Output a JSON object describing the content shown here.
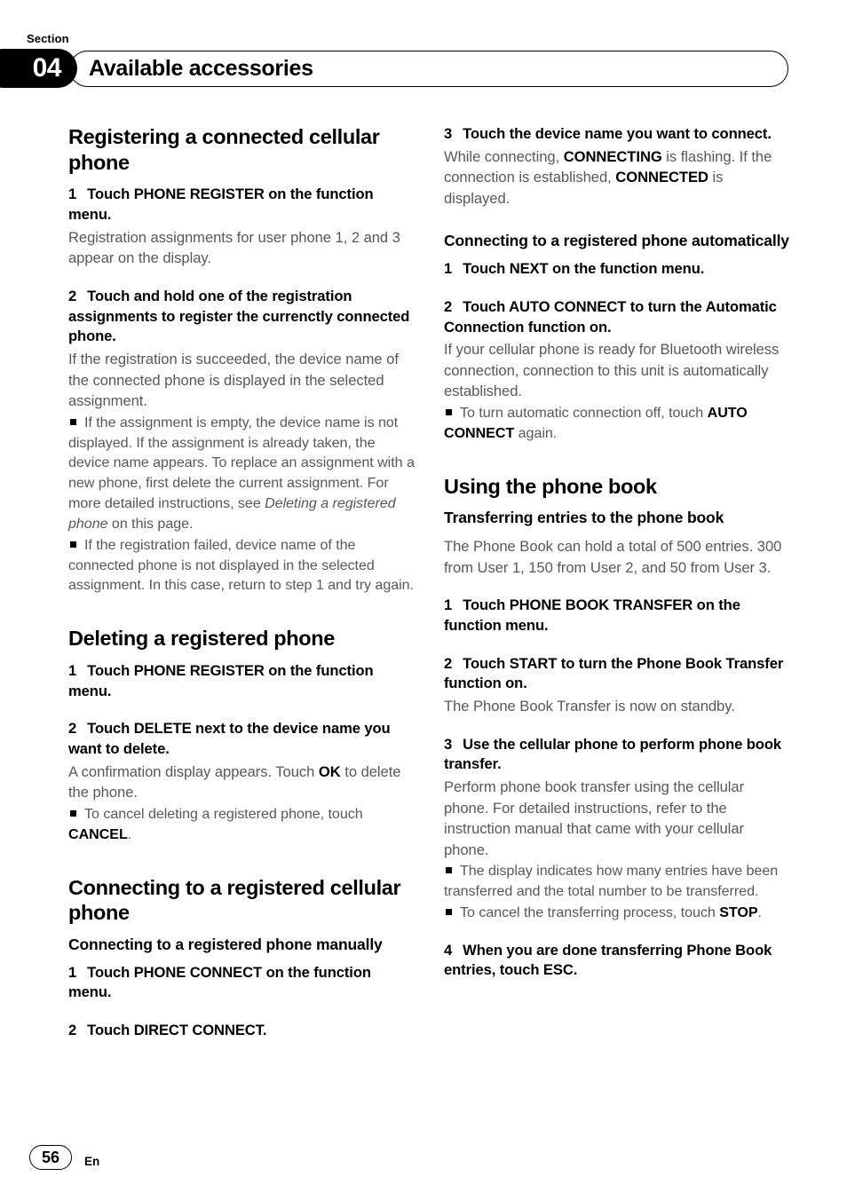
{
  "header": {
    "section_label": "Section",
    "section_number": "04",
    "title": "Available accessories"
  },
  "footer": {
    "page_number": "56",
    "language_code": "En"
  },
  "left_column": {
    "heading_1": "Registering a connected cellular phone",
    "step_1_num": "1",
    "step_1_text": "Touch PHONE REGISTER on the function menu.",
    "step_1_body": "Registration assignments for user phone 1, 2 and 3 appear on the display.",
    "step_2_num": "2",
    "step_2_text": "Touch and hold one of the registration assignments to register the currenctly connected phone.",
    "step_2_body": "If the registration is succeeded, the device name of the connected phone is displayed in the selected assignment.",
    "bullet_1_a": "If the assignment is empty, the device name is not displayed. If the assignment is already taken, the device name appears. To replace an assignment with a new phone, first delete the current assignment. For more detailed instructions, see ",
    "bullet_1_italic": "Deleting a registered phone",
    "bullet_1_b": " on this page.",
    "bullet_2": "If the registration failed, device name of the connected phone is not displayed in the selected assignment. In this case, return to step 1 and try again.",
    "heading_2": "Deleting a registered phone",
    "del_step_1_num": "1",
    "del_step_1_text": "Touch PHONE REGISTER on the function menu.",
    "del_step_2_num": "2",
    "del_step_2_text": "Touch DELETE next to the device name you want to delete.",
    "del_step_2_body_a": "A confirmation display appears. Touch ",
    "del_step_2_body_bold": "OK",
    "del_step_2_body_b": " to delete the phone.",
    "del_bullet_a": "To cancel deleting a registered phone, touch ",
    "del_bullet_bold": "CANCEL",
    "del_bullet_b": ".",
    "heading_3": "Connecting to a registered cellular phone",
    "sub_heading_1": "Connecting to a registered phone manually",
    "conn_step_1_num": "1",
    "conn_step_1_text": "Touch PHONE CONNECT on the function menu.",
    "conn_step_2_num": "2",
    "conn_step_2_text": "Touch DIRECT CONNECT."
  },
  "right_column": {
    "conn_step_3_num": "3",
    "conn_step_3_text": "Touch the device name you want to connect.",
    "conn_step_3_body_a": "While connecting, ",
    "conn_step_3_body_bold_1": "CONNECTING",
    "conn_step_3_body_b": " is flashing. If the connection is established, ",
    "conn_step_3_body_bold_2": "CONNECTED",
    "conn_step_3_body_c": " is displayed.",
    "sub_heading_auto": "Connecting to a registered phone automatically",
    "auto_step_1_num": "1",
    "auto_step_1_text": "Touch NEXT on the function menu.",
    "auto_step_2_num": "2",
    "auto_step_2_text": "Touch AUTO CONNECT to turn the Automatic Connection function on.",
    "auto_step_2_body": "If your cellular phone is ready for Bluetooth wireless connection, connection to this unit is automatically established.",
    "auto_bullet_a": "To turn automatic connection off, touch ",
    "auto_bullet_bold": "AUTO CONNECT",
    "auto_bullet_b": " again.",
    "heading_phone_book": "Using the phone book",
    "sub_heading_transfer": "Transferring entries to the phone book",
    "transfer_intro": "The Phone Book can hold a total of 500 entries. 300 from User 1, 150 from User 2, and 50 from User 3.",
    "pb_step_1_num": "1",
    "pb_step_1_text": "Touch PHONE BOOK TRANSFER on the function menu.",
    "pb_step_2_num": "2",
    "pb_step_2_text": "Touch START to turn the Phone Book Transfer function on.",
    "pb_step_2_body": "The Phone Book Transfer is now on standby.",
    "pb_step_3_num": "3",
    "pb_step_3_text": "Use the cellular phone to perform phone book transfer.",
    "pb_step_3_body": "Perform phone book transfer using the cellular phone. For detailed instructions, refer to the instruction manual that came with your cellular phone.",
    "pb_bullet_1": "The display indicates how many entries have been transferred and the total number to be transferred.",
    "pb_bullet_2_a": "To cancel the transferring process, touch ",
    "pb_bullet_2_bold": "STOP",
    "pb_bullet_2_b": ".",
    "pb_step_4_num": "4",
    "pb_step_4_text": "When you are done transferring Phone Book entries, touch ESC."
  }
}
